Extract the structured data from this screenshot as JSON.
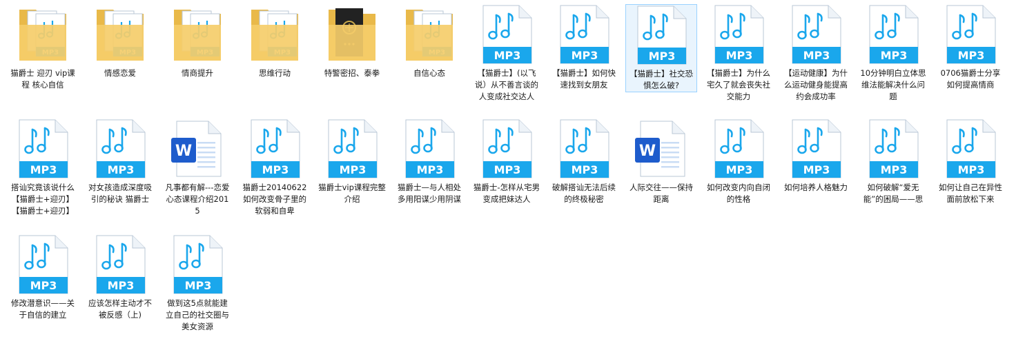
{
  "rows": [
    [
      {
        "type": "folder",
        "label": "猫爵士 迎刃 vip课程 核心自信"
      },
      {
        "type": "folder",
        "label": "情感恋爱"
      },
      {
        "type": "folder",
        "label": "情商提升"
      },
      {
        "type": "folder",
        "label": "思维行动"
      },
      {
        "type": "folder-dark",
        "label": "特警密招、泰拳"
      },
      {
        "type": "folder",
        "label": "自信心态"
      },
      {
        "type": "mp3",
        "label": "【猫爵士】(以飞说）从不善言谈的人变成社交达人"
      },
      {
        "type": "mp3",
        "label": "【猫爵士】如何快速找到女朋友"
      },
      {
        "type": "mp3",
        "label": "【猫爵士】社交恐惧怎么破?",
        "selected": true
      },
      {
        "type": "mp3",
        "label": "【猫爵士】为什么宅久了就会丧失社交能力"
      },
      {
        "type": "mp3",
        "label": "【运动健康】为什么运动健身能提高约会成功率"
      },
      {
        "type": "mp3",
        "label": "10分钟明白立体思维法能解决什么问题"
      },
      {
        "type": "mp3",
        "label": "0706猫爵士分享如何提高情商"
      }
    ],
    [
      {
        "type": "mp3",
        "label": "搭讪究竟该说什么【猫爵士+迎刃】【猫爵士+迎刃】"
      },
      {
        "type": "mp3",
        "label": "对女孩造成深度吸引的秘诀 猫爵士"
      },
      {
        "type": "word",
        "label": "凡事都有解---恋爱心态课程介绍2015"
      },
      {
        "type": "mp3",
        "label": "猫爵士20140622如何改变骨子里的软弱和自卑"
      },
      {
        "type": "mp3",
        "label": "猫爵士vip课程完整介绍"
      },
      {
        "type": "mp3",
        "label": "猫爵士—与人相处多用阳谋少用阴谋"
      },
      {
        "type": "mp3",
        "label": "猫爵士-怎样从宅男变成把妹达人"
      },
      {
        "type": "mp3",
        "label": "破解搭讪无法后续的终极秘密"
      },
      {
        "type": "word",
        "label": "人际交往——保持距离"
      },
      {
        "type": "mp3",
        "label": "如何改变内向自闭的性格"
      },
      {
        "type": "mp3",
        "label": "如何培养人格魅力"
      },
      {
        "type": "mp3",
        "label": "如何破解“爱无能”的困局——思"
      },
      {
        "type": "mp3",
        "label": "如何让自己在异性面前放松下来"
      }
    ],
    [
      {
        "type": "mp3",
        "label": "修改潜意识——关于自信的建立"
      },
      {
        "type": "mp3",
        "label": "应该怎样主动才不被反感（上)"
      },
      {
        "type": "mp3",
        "label": "做到这5点就能建立自己的社交圈与美女资源"
      }
    ]
  ],
  "icon_text": {
    "mp3": "MP3",
    "word": "W"
  },
  "colors": {
    "mp3_band": "#1aa7ec",
    "mp3_note": "#1aa7ec",
    "word_blue": "#1e5ccc",
    "folder_yellow": "#f5cd6a",
    "selection": "#e9f4fd"
  }
}
